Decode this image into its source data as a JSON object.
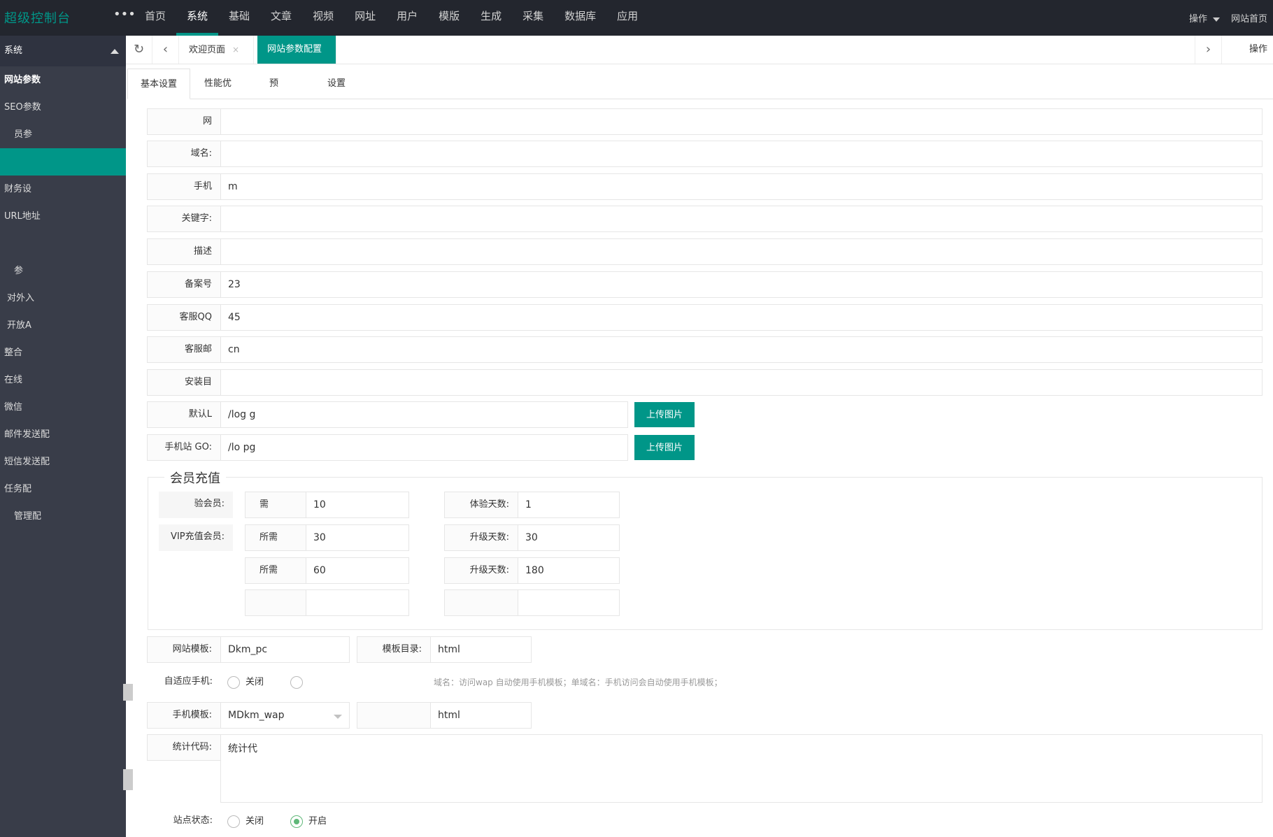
{
  "topbar": {
    "logo": "超级控制台",
    "more": "•••",
    "nav": [
      "首页",
      "系统",
      "基础",
      "文章",
      "视频",
      "网址",
      "用户",
      "模版",
      "生成",
      "采集",
      "数据库",
      "应用"
    ],
    "active_nav": "系统",
    "right_op": "操作",
    "right_home": "网站首页"
  },
  "sidebar": {
    "head": "系统",
    "items": [
      "网站参数",
      "SEO参数",
      "员参",
      "",
      "财务设",
      "URL地址",
      "",
      "参",
      "对外入",
      "开放A",
      "整合",
      "在线",
      "微信",
      "邮件发送配",
      "短信发送配",
      "任务配",
      "管理配"
    ]
  },
  "tabsbar": {
    "tab_welcome": "欢迎页面",
    "tab_close": "×",
    "tab_active": "网站参数配置",
    "right_op": "操作"
  },
  "innertabs": [
    "基本设置",
    "性能优",
    "预",
    "设置"
  ],
  "form": {
    "site_name": {
      "label": "网",
      "value": ""
    },
    "domain": {
      "label": "域名:",
      "value": ""
    },
    "mobile_domain": {
      "label": "手机",
      "value": "m"
    },
    "keywords": {
      "label": "关键字:",
      "value": ""
    },
    "description": {
      "label": "描述",
      "value": ""
    },
    "icp": {
      "label": "备案号",
      "value": "23"
    },
    "qq": {
      "label": "客服QQ",
      "value": "45"
    },
    "email": {
      "label": "客服邮",
      "value": "cn"
    },
    "install_dir": {
      "label": "安装目",
      "value": ""
    },
    "logo": {
      "label": "默认L",
      "value": "/log g"
    },
    "mobile_logo": {
      "label": "手机站 GO:",
      "value": "/lo pg"
    },
    "upload_label": "上传图片"
  },
  "member": {
    "legend": "会员充值",
    "trial_label": "验会员:",
    "vip_label": "VIP充值会员:",
    "need_label": "需",
    "price_label": "所需",
    "trial_price": "10",
    "trial_days_label": "体验天数:",
    "trial_days": "1",
    "vip_price1": "30",
    "upgrade_days_label": "升级天数:",
    "upgrade_days1": "30",
    "vip_price2": "60",
    "upgrade_days2": "180"
  },
  "template": {
    "site_tpl_label": "网站模板:",
    "site_tpl_value": "Dkm_pc",
    "tpl_dir_label": "模板目录:",
    "tpl_dir_value": "html",
    "adaptive_label": "自适应手机:",
    "off": "关闭",
    "hint": "域名：访问wap 自动使用手机模板；单域名：手机访问会自动使用手机模板；",
    "mobile_tpl_label": "手机模板:",
    "mobile_tpl_value": "MDkm_wap",
    "mobile_dir_value": "html"
  },
  "stats": {
    "label": "统计代码:",
    "value": "统计代"
  },
  "status": {
    "label": "站点状态:",
    "off": "关闭",
    "on": "开启"
  },
  "colors": {
    "accent": "#009688",
    "topbar": "#23262e",
    "sidebar": "#393d49"
  }
}
